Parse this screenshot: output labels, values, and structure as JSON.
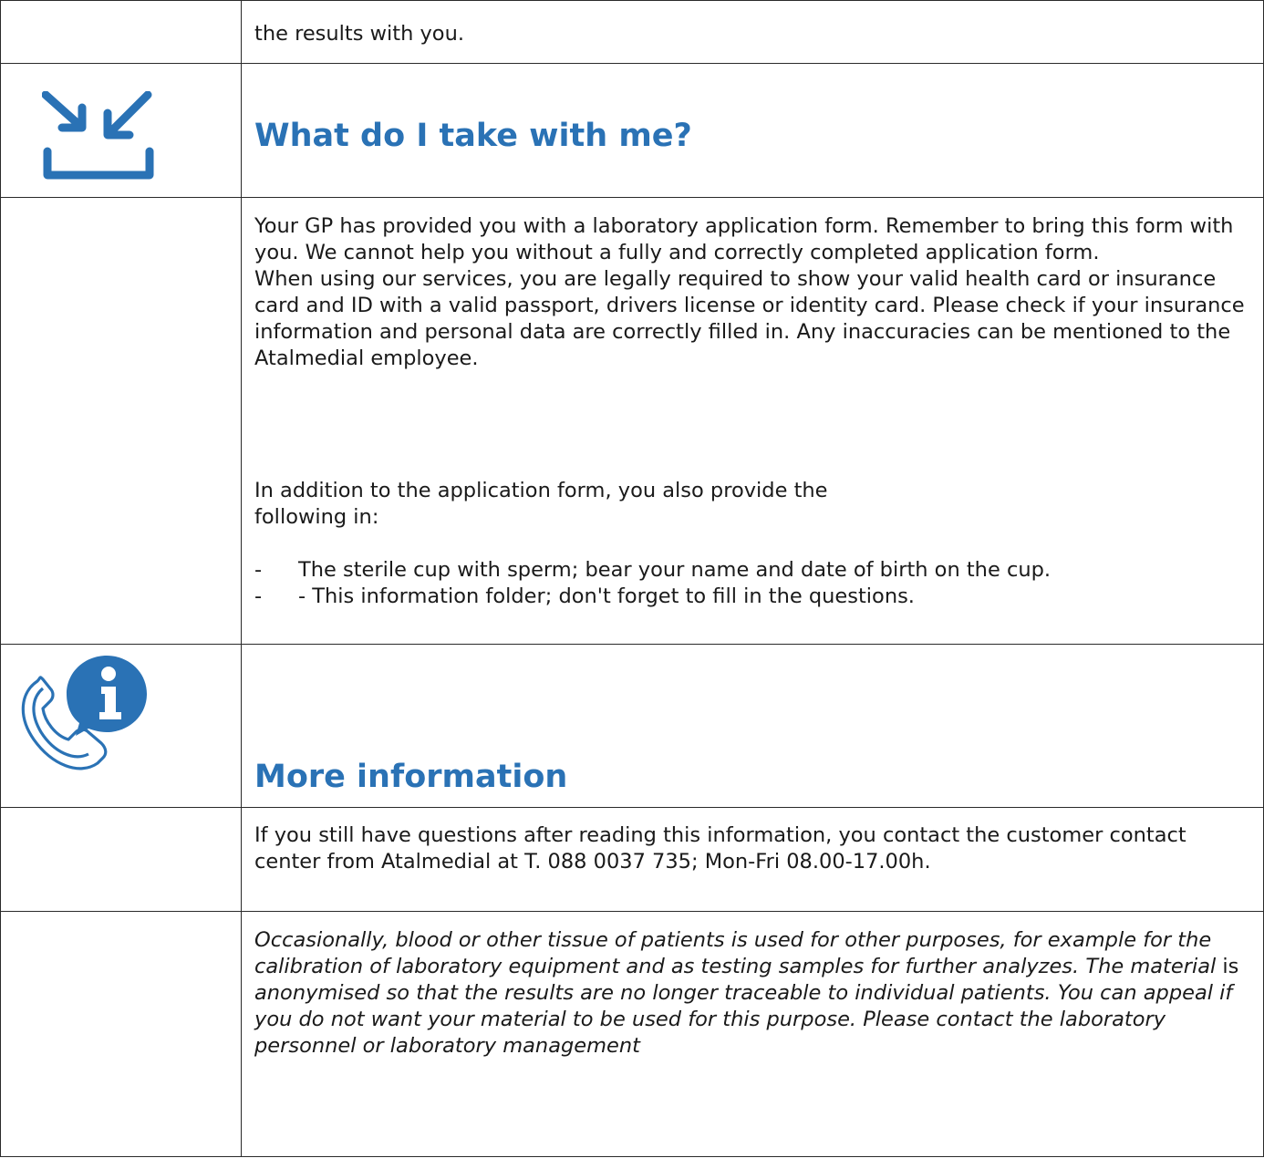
{
  "row_results": {
    "text": "the results with you."
  },
  "section_take": {
    "icon": "download-tray-icon",
    "heading": "What do I take with me?",
    "paragraph1": "Your GP has provided you with a laboratory application form. Remember to bring this form with you. We cannot help you without a fully and correctly completed application form.",
    "paragraph2": "When using our services, you are legally required to show your valid health card or insurance card and ID with a valid passport, drivers license or identity card. Please check if your insurance information and personal data are correctly filled in. Any inaccuracies can be mentioned to the Atalmedial employee.",
    "paragraph3_line1": "In addition to the application form, you also provide the",
    "paragraph3_line2": "following in:",
    "bullets": [
      {
        "dash": "-",
        "text": "The sterile cup with sperm; bear your name and date of birth on the cup."
      },
      {
        "dash": "-",
        "text": "- This information folder; don't forget to fill in the questions."
      }
    ]
  },
  "section_info": {
    "icon": "phone-info-icon",
    "heading": "More information",
    "paragraph": "If you still have questions after reading this information, you contact the customer contact center from Atalmedial at T. 088 0037 735; Mon-Fri 08.00-17.00h."
  },
  "footnote": {
    "part1": "Occasionally, blood or other tissue of patients is used for other purposes, for example for the calibration of laboratory equipment and as testing samples for further analyzes. The material ",
    "part2": "is",
    "part3": " anonymised so that the results are no longer traceable to individual patients. You can appeal if you do not want your material to be used for this purpose. Please contact the laboratory personnel or laboratory management"
  },
  "colors": {
    "heading": "#2a72b5",
    "icon": "#2a72b5",
    "border": "#2a2a2a"
  }
}
